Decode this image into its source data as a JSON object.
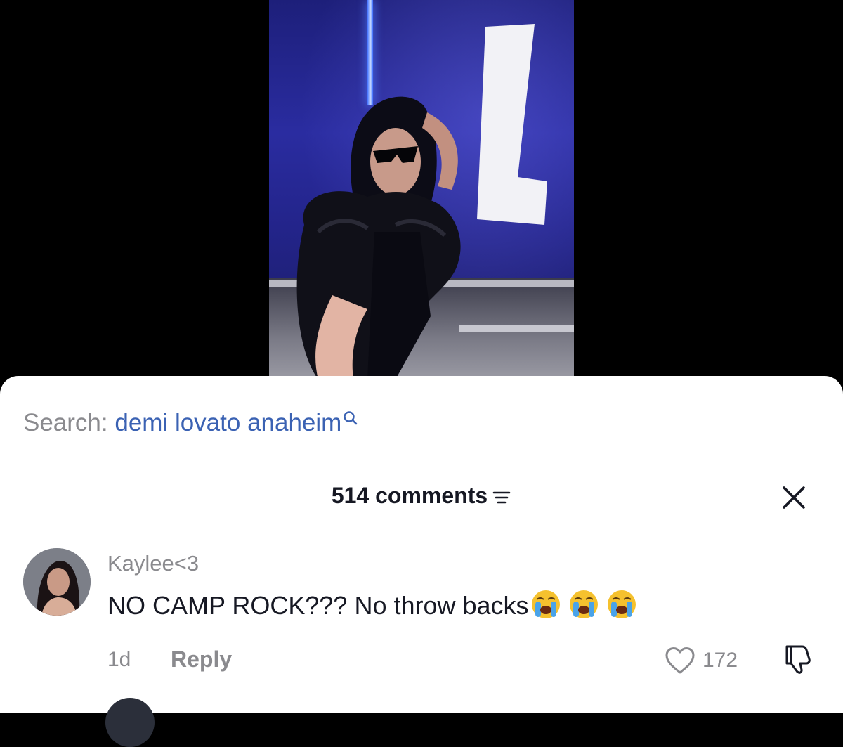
{
  "search": {
    "prefix": "Search:",
    "query": "demi lovato anaheim"
  },
  "comments_panel": {
    "count_label": "514 comments"
  },
  "comments": [
    {
      "username": "Kaylee<3",
      "text": "NO CAMP ROCK??? No throw backs",
      "emojis": [
        "loudly-crying-face",
        "loudly-crying-face",
        "loudly-crying-face"
      ],
      "time": "1d",
      "reply_label": "Reply",
      "likes": "172"
    }
  ],
  "colors": {
    "search_query": "#3b62b3",
    "muted_text": "#8a8a8e",
    "primary_text": "#161823",
    "sheet_background": "#ffffff",
    "video_background": "#000000"
  }
}
